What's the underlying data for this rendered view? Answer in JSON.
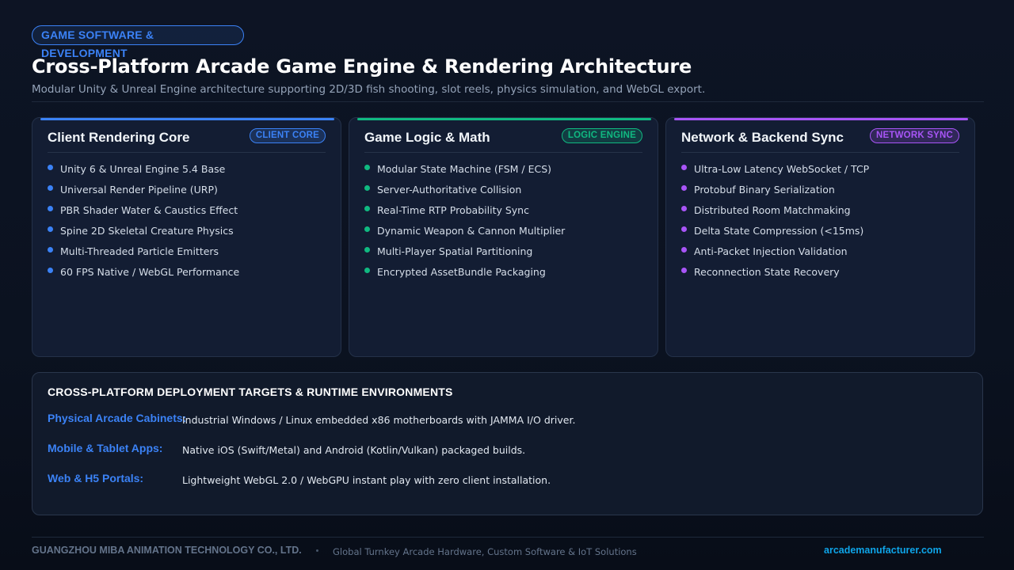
{
  "header": {
    "tag": "GAME SOFTWARE & DEVELOPMENT",
    "title": "Cross-Platform Arcade Game Engine & Rendering Architecture",
    "subtitle": "Modular Unity & Unreal Engine architecture supporting 2D/3D fish shooting, slot reels, physics simulation, and WebGL export."
  },
  "cards": [
    {
      "title": "Client Rendering Core",
      "badge": "CLIENT CORE",
      "accent_color": "#3b82f6",
      "items": [
        "Unity 6 & Unreal Engine 5.4 Base",
        "Universal Render Pipeline (URP)",
        "PBR Shader Water & Caustics Effect",
        "Spine 2D Skeletal Creature Physics",
        "Multi-Threaded Particle Emitters",
        "60 FPS Native / WebGL Performance"
      ]
    },
    {
      "title": "Game Logic & Math",
      "badge": "LOGIC ENGINE",
      "accent_color": "#10b981",
      "items": [
        "Modular State Machine (FSM / ECS)",
        "Server-Authoritative Collision",
        "Real-Time RTP Probability Sync",
        "Dynamic Weapon & Cannon Multiplier",
        "Multi-Player Spatial Partitioning",
        "Encrypted AssetBundle Packaging"
      ]
    },
    {
      "title": "Network & Backend Sync",
      "badge": "NETWORK SYNC",
      "accent_color": "#a855f7",
      "items": [
        "Ultra-Low Latency WebSocket / TCP",
        "Protobuf Binary Serialization",
        "Distributed Room Matchmaking",
        "Delta State Compression (<15ms)",
        "Anti-Packet Injection Validation",
        "Reconnection State Recovery"
      ]
    }
  ],
  "deployment": {
    "title": "CROSS-PLATFORM DEPLOYMENT TARGETS & RUNTIME ENVIRONMENTS",
    "rows": [
      {
        "label": "Physical Arcade Cabinets:",
        "value": "Industrial Windows / Linux embedded x86 motherboards with JAMMA I/O driver."
      },
      {
        "label": "Mobile & Tablet Apps:",
        "value": "Native iOS (Swift/Metal) and Android (Kotlin/Vulkan) packaged builds."
      },
      {
        "label": "Web & H5 Portals:",
        "value": "Lightweight WebGL 2.0 / WebGPU instant play with zero client installation."
      }
    ]
  },
  "footer": {
    "company": "GUANGZHOU MIBA ANIMATION TECHNOLOGY CO., LTD.",
    "tagline": "Global Turnkey Arcade Hardware, Custom Software & IoT Solutions",
    "url": "arcademanufacturer.com"
  }
}
